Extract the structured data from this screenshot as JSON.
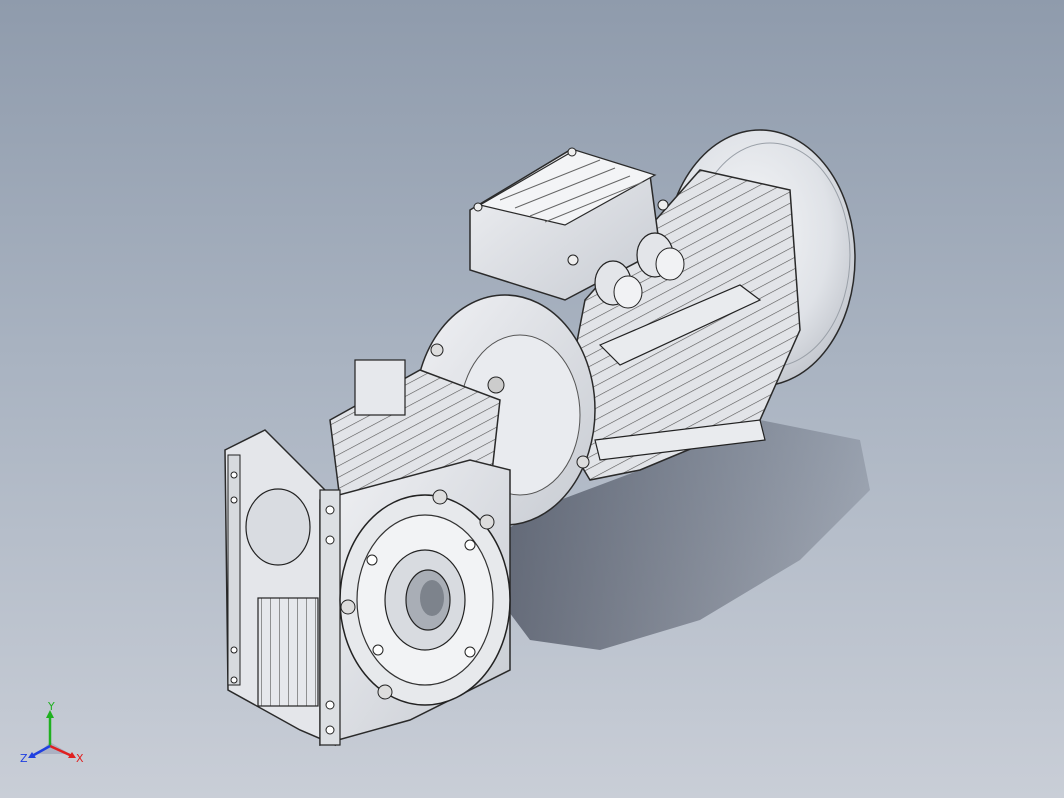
{
  "viewport": {
    "background_top": "#8f9bac",
    "background_bottom": "#c9ced7"
  },
  "triad": {
    "x_label": "X",
    "y_label": "Y",
    "z_label": "Z",
    "x_color": "#e02020",
    "y_color": "#20b020",
    "z_color": "#2040e0"
  },
  "model": {
    "name_icon": "gearmotor-3d-model",
    "motor_color": "#d8dbe0",
    "housing_color": "#e4e6ea",
    "edge_color": "#2a2a2a",
    "shadow_color": "#3b4150"
  }
}
